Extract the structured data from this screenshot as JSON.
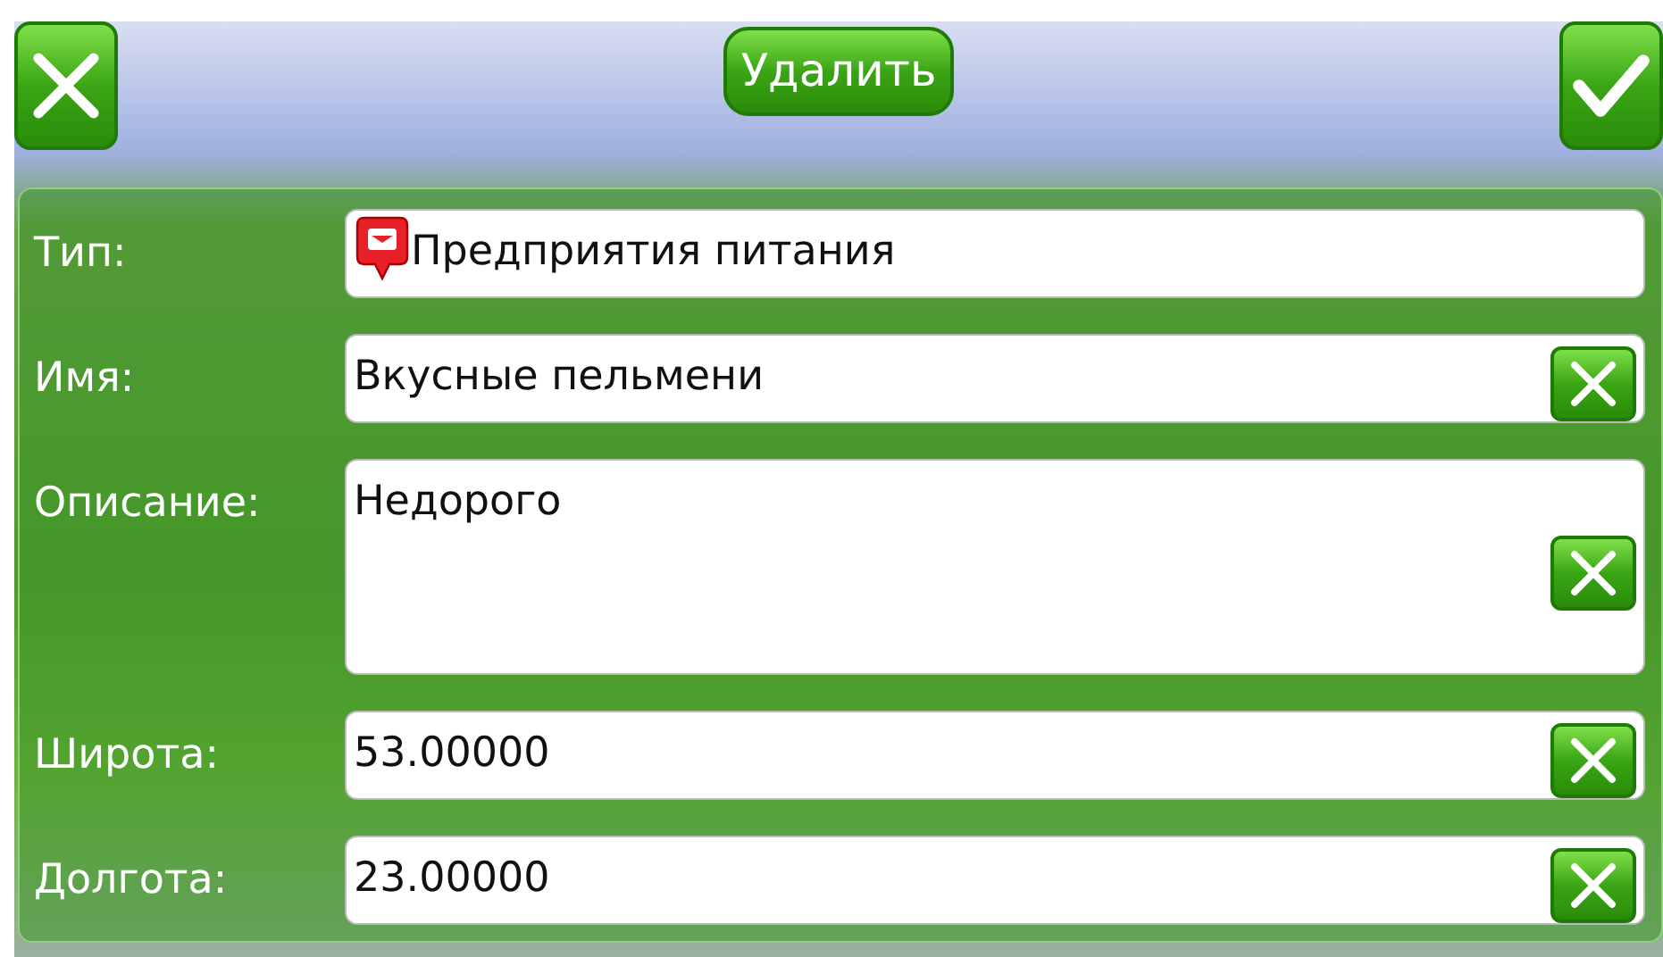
{
  "header": {
    "cancel_button": {
      "kind": "cancel"
    },
    "delete_button": {
      "label": "Удалить"
    },
    "ok_button": {
      "kind": "ok"
    }
  },
  "fields": [
    {
      "kind": "category",
      "label": "Тип:",
      "value": "Предприятия питания",
      "clearable": false
    },
    {
      "kind": "line",
      "label": "Имя:",
      "value": "Вкусные пельмени",
      "clearable": true
    },
    {
      "kind": "multiline",
      "label": "Описание:",
      "value": "Недорого",
      "clearable": true
    },
    {
      "kind": "line",
      "label": "Широта:",
      "value": "53.00000",
      "clearable": true
    },
    {
      "kind": "line",
      "label": "Долгота:",
      "value": "23.00000",
      "clearable": true
    }
  ]
}
